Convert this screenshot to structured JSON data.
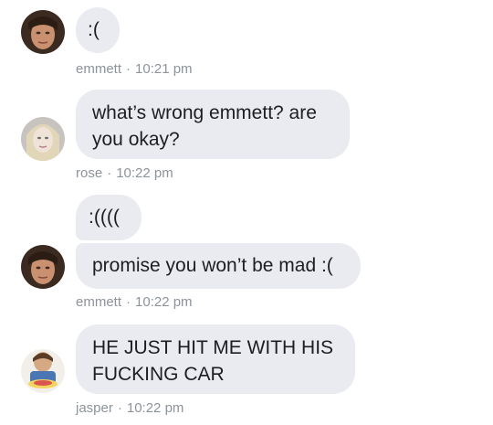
{
  "messages": [
    {
      "sender": "emmett",
      "lines": [
        ":("
      ]
    },
    {
      "sender": "rose",
      "lines": [
        "what’s wrong emmett? are",
        "you okay?"
      ]
    },
    {
      "sender": "emmett",
      "lines": [
        ":(((("
      ]
    },
    {
      "sender": "emmett",
      "lines": [
        "promise you won’t be mad :("
      ]
    },
    {
      "sender": "jasper",
      "lines": [
        "HE JUST HIT ME WITH HIS",
        "FUCKING CAR"
      ]
    }
  ],
  "metas": [
    {
      "name": "emmett",
      "sep": "·",
      "time": "10:21 pm"
    },
    {
      "name": "rose",
      "sep": "·",
      "time": "10:22 pm"
    },
    {
      "name": "emmett",
      "sep": "·",
      "time": "10:22 pm"
    },
    {
      "name": "jasper",
      "sep": "·",
      "time": "10:22 pm"
    }
  ],
  "avatars": [
    {
      "person": "emmett",
      "icon": "avatar-photo"
    },
    {
      "person": "rose",
      "icon": "avatar-photo"
    },
    {
      "person": "emmett",
      "icon": "avatar-photo"
    },
    {
      "person": "jasper",
      "icon": "avatar-photo"
    }
  ],
  "colors": {
    "bubble": "#e9ebf0",
    "text": "#1c1e21",
    "meta": "#8d939b"
  }
}
